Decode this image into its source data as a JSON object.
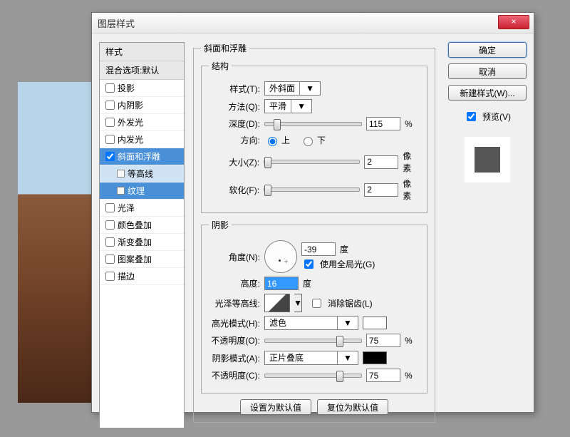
{
  "title": "图层样式",
  "close": "×",
  "left": {
    "styles_header": "样式",
    "blend_header": "混合选项:默认",
    "items": [
      {
        "label": "投影",
        "checked": false
      },
      {
        "label": "内阴影",
        "checked": false
      },
      {
        "label": "外发光",
        "checked": false
      },
      {
        "label": "内发光",
        "checked": false
      },
      {
        "label": "斜面和浮雕",
        "checked": true,
        "active": true
      },
      {
        "label": "等高线",
        "sub": true
      },
      {
        "label": "纹理",
        "sub": true,
        "selected": true
      },
      {
        "label": "光泽",
        "checked": false
      },
      {
        "label": "颜色叠加",
        "checked": false
      },
      {
        "label": "渐变叠加",
        "checked": false
      },
      {
        "label": "图案叠加",
        "checked": false
      },
      {
        "label": "描边",
        "checked": false
      }
    ]
  },
  "panel_title": "斜面和浮雕",
  "struct": {
    "legend": "结构",
    "style_lbl": "样式(T):",
    "style_val": "外斜面",
    "tech_lbl": "方法(Q):",
    "tech_val": "平滑",
    "depth_lbl": "深度(D):",
    "depth_val": "115",
    "pct": "%",
    "dir_lbl": "方向:",
    "up": "上",
    "down": "下",
    "size_lbl": "大小(Z):",
    "size_val": "2",
    "px": "像素",
    "soften_lbl": "软化(F):",
    "soften_val": "2"
  },
  "shade": {
    "legend": "阴影",
    "angle_lbl": "角度(N):",
    "angle_val": "-39",
    "deg": "度",
    "global_lbl": "使用全局光(G)",
    "alt_lbl": "高度:",
    "alt_val": "16",
    "gloss_lbl": "光泽等高线:",
    "aa_lbl": "消除锯齿(L)",
    "hmode_lbl": "高光模式(H):",
    "hmode_val": "滤色",
    "hopac_lbl": "不透明度(O):",
    "hopac_val": "75",
    "smode_lbl": "阴影模式(A):",
    "smode_val": "正片叠底",
    "sopac_lbl": "不透明度(C):",
    "sopac_val": "75"
  },
  "btm": {
    "default": "设置为默认值",
    "reset": "复位为默认值"
  },
  "right": {
    "ok": "确定",
    "cancel": "取消",
    "newstyle": "新建样式(W)...",
    "preview": "预览(V)"
  }
}
